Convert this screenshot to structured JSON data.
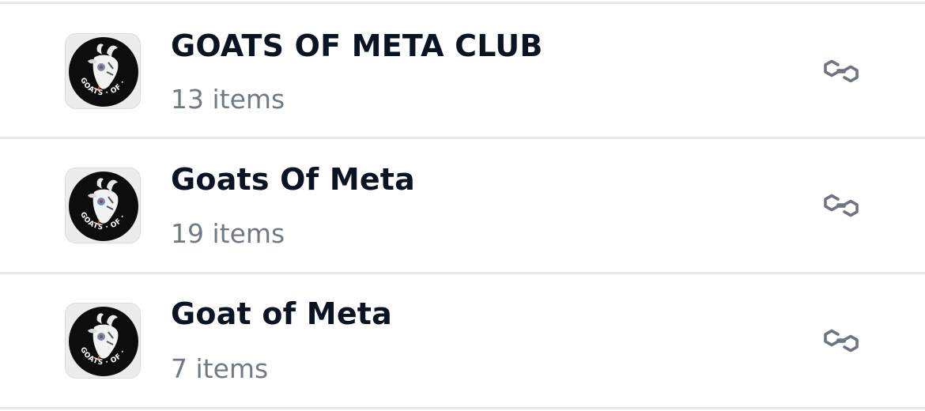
{
  "collections": [
    {
      "name": "GOATS OF META CLUB",
      "count": "13 items",
      "logo_icon": "goats-of-meta-logo-icon",
      "chain_icon": "polygon-icon"
    },
    {
      "name": "Goats Of Meta",
      "count": "19 items",
      "logo_icon": "goats-of-meta-logo-icon",
      "chain_icon": "polygon-icon"
    },
    {
      "name": "Goat of Meta",
      "count": "7 items",
      "logo_icon": "goats-of-meta-logo-icon",
      "chain_icon": "polygon-icon"
    }
  ],
  "logo_text": "GOATS · OF · META",
  "colors": {
    "title": "#0b1423",
    "subtitle": "#707a86",
    "divider": "#e6e7e9",
    "icon": "#6d7580"
  }
}
